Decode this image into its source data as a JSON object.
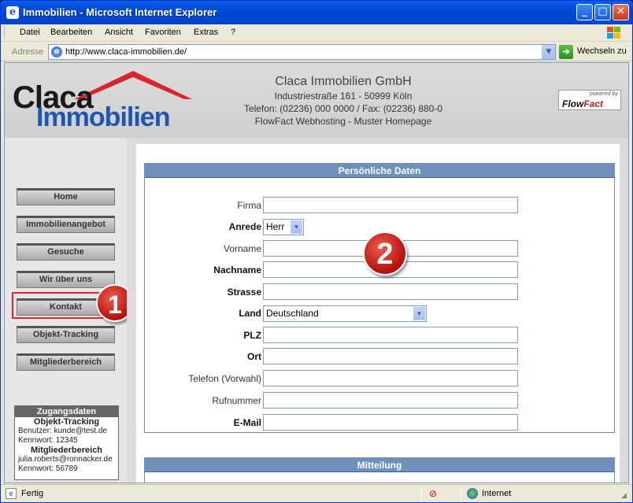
{
  "window": {
    "title": "Immobilien - Microsoft Internet Explorer",
    "min_glyph": "_",
    "max_glyph": "□",
    "close_glyph": "✕"
  },
  "menu": {
    "items": [
      "Datei",
      "Bearbeiten",
      "Ansicht",
      "Favoriten",
      "Extras",
      "?"
    ]
  },
  "address": {
    "label": "Adresse",
    "url": "http://www.claca-immobilien.de/",
    "go_label": "Wechseln zu"
  },
  "header": {
    "logo_top": "Claca",
    "logo_bottom": "Immobilien",
    "company_name": "Claca Immobilien GmbH",
    "street": "Industriestraße 161 - 50999 Köln",
    "phone": "Telefon: (02236) 000 0000 / Fax: (02236) 880-0",
    "tagline": "FlowFact Webhosting - Muster Homepage",
    "powered_by": "powered by",
    "flowfact_prefix": "Flow",
    "flowfact_suffix": "Fact"
  },
  "nav": {
    "items": [
      "Home",
      "Immobilienangebot",
      "Gesuche",
      "Wir über uns",
      "Kontakt",
      "Objekt-Tracking",
      "Mitgliederbereich"
    ]
  },
  "badges": {
    "one": "1",
    "two": "2"
  },
  "login": {
    "title": "Zugangsdaten",
    "tracking_heading": "Objekt-Tracking",
    "tracking_user": "Benutzer: kunde@test.de",
    "tracking_pass": "Kennwort: 12345",
    "members_heading": "Mitgliederbereich",
    "members_user": "julia.roberts@ronnacker.de",
    "members_pass": "Kennwort: 56789"
  },
  "form": {
    "panel_title": "Persönliche Daten",
    "fields": {
      "firma": "Firma",
      "anrede": "Anrede",
      "vorname": "Vorname",
      "nachname": "Nachname",
      "strasse": "Strasse",
      "land": "Land",
      "plz": "PLZ",
      "ort": "Ort",
      "telefon": "Telefon (Vorwahl)",
      "rufnummer": "Rufnummer",
      "email": "E-Mail"
    },
    "anrede_value": "Herr",
    "land_value": "Deutschland",
    "panel2_title": "Mitteilung"
  },
  "status": {
    "text": "Fertig",
    "zone": "Internet"
  }
}
